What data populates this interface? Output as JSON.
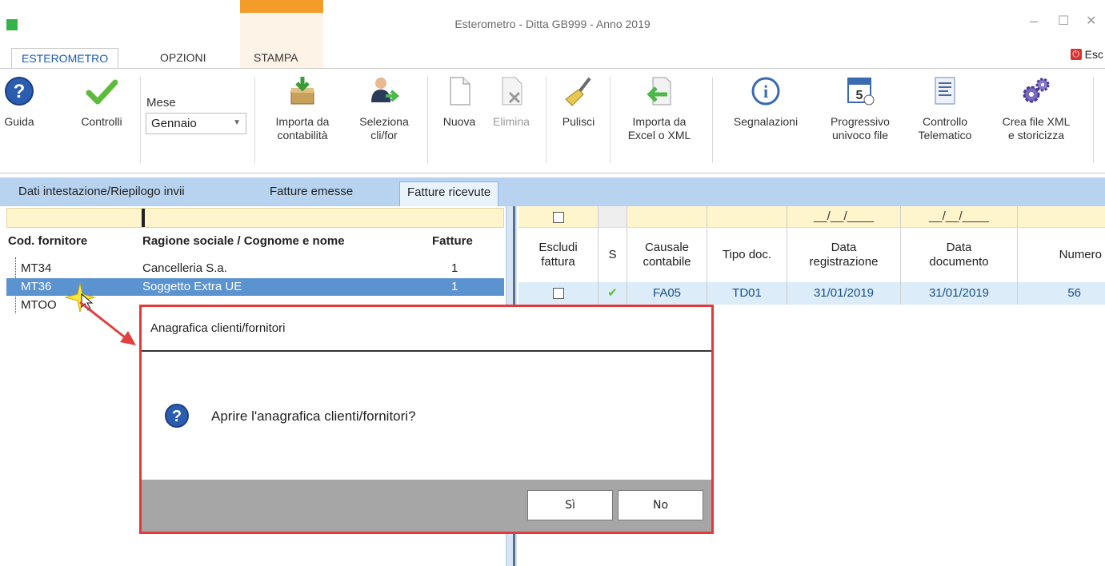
{
  "window": {
    "title": "Esterometro - Ditta GB999 - Anno 2019",
    "minimize": "–",
    "maximize": "☐",
    "close": "✕"
  },
  "ribbon_tabs": [
    {
      "label": "ESTEROMETRO"
    },
    {
      "label": "OPZIONI"
    },
    {
      "label": "STAMPA"
    }
  ],
  "esci": {
    "label": "Esc"
  },
  "ribbon": {
    "guida": "Guida",
    "controlli": "Controlli",
    "mese_label": "Mese",
    "mese_value": "Gennaio",
    "importa_contab_1": "Importa da",
    "importa_contab_2": "contabilità",
    "seleziona_1": "Seleziona",
    "seleziona_2": "cli/for",
    "nuova": "Nuova",
    "elimina": "Elimina",
    "pulisci": "Pulisci",
    "importa_excel_1": "Importa da",
    "importa_excel_2": "Excel o XML",
    "segnalazioni": "Segnalazioni",
    "progressivo_1": "Progressivo",
    "progressivo_2": "univoco file",
    "controllo_1": "Controllo",
    "controllo_2": "Telematico",
    "crea_1": "Crea file XML",
    "crea_2": "e storicizza"
  },
  "sub_tabs": [
    {
      "label": "Dati intestazione/Riepilogo invii"
    },
    {
      "label": "Fatture emesse"
    },
    {
      "label": "Fatture ricevute"
    }
  ],
  "left_panel": {
    "headers": {
      "cod": "Cod. fornitore",
      "ragione": "Ragione sociale / Cognome e nome",
      "fatture": "Fatture"
    },
    "rows": [
      {
        "cod": "MT34",
        "ragione": "Cancelleria S.a.",
        "fatture": "1"
      },
      {
        "cod": "MT36",
        "ragione": "Soggetto Extra UE",
        "fatture": "1"
      },
      {
        "cod": "MTOO",
        "ragione": "",
        "fatture": ""
      }
    ]
  },
  "grid": {
    "date_placeholder": "__/__/____",
    "headers": {
      "escludi_1": "Escludi",
      "escludi_2": "fattura",
      "s": "S",
      "causale_1": "Causale",
      "causale_2": "contabile",
      "tipo": "Tipo doc.",
      "data_reg_1": "Data",
      "data_reg_2": "registrazione",
      "data_doc_1": "Data",
      "data_doc_2": "documento",
      "numero": "Numero"
    },
    "row": {
      "causale": "FA05",
      "tipo": "TD01",
      "data_reg": "31/01/2019",
      "data_doc": "31/01/2019",
      "numero": "56"
    }
  },
  "dialog": {
    "title": "Anagrafica clienti/fornitori",
    "message": "Aprire l'anagrafica clienti/fornitori?",
    "yes": "Sì",
    "no": "No"
  },
  "colors": {
    "highlight_border": "#e23a3a",
    "selected_row": "#5b92d0",
    "subtab_bar": "#b8d3f0"
  }
}
